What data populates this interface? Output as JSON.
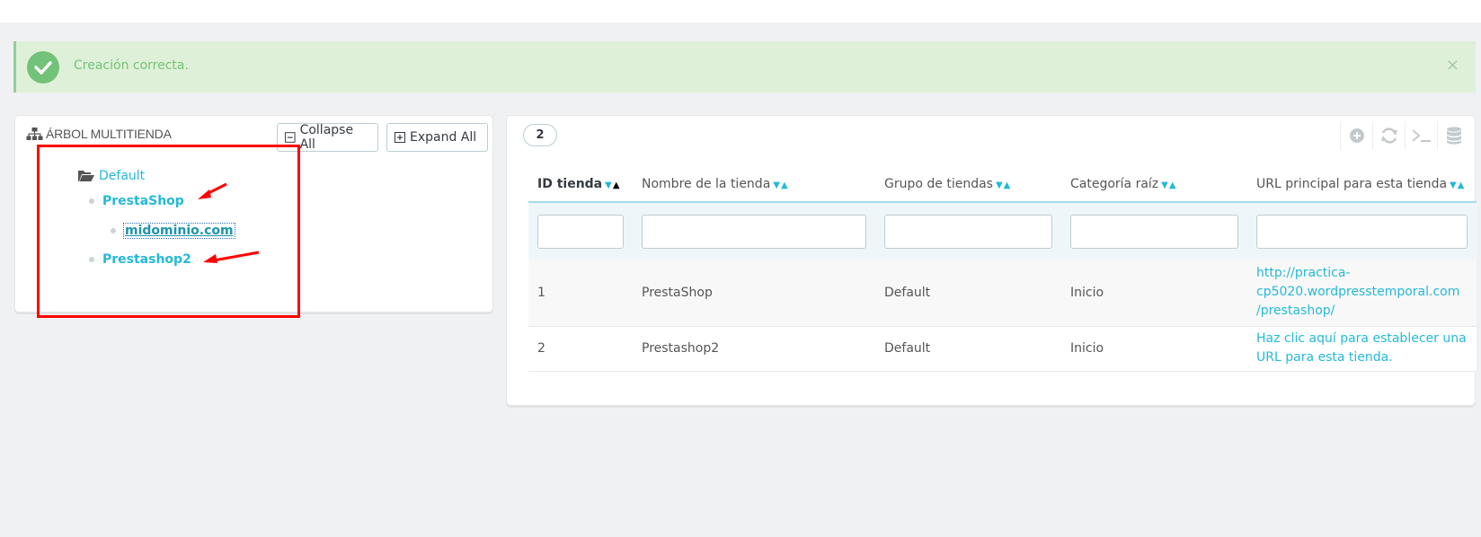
{
  "alert": {
    "message": "Creación correcta.",
    "close": "×",
    "icon": "check-circle-icon",
    "color": "#72c279"
  },
  "tree": {
    "title": "ÁRBOL MULTITIENDA",
    "collapse_label": "Collapse All",
    "expand_label": "Expand All",
    "root_label": "Default",
    "shop1_label": "PrestaShop",
    "shop1_url": "midominio.com",
    "shop2_label": "Prestashop2"
  },
  "list": {
    "count": "2",
    "columns": {
      "id": "ID tienda",
      "name": "Nombre de la tienda",
      "group": "Grupo de tiendas",
      "category": "Categoría raíz",
      "url": "URL principal para esta tienda"
    },
    "rows": [
      {
        "id": "1",
        "name": "PrestaShop",
        "group": "Default",
        "category": "Inicio",
        "url_line1": "http://practica-",
        "url_line2": "cp5020.wordpresstemporal.com",
        "url_line3": "/prestashop/"
      },
      {
        "id": "2",
        "name": "Prestashop2",
        "group": "Default",
        "category": "Inicio",
        "url_line1": "Haz clic aquí para establecer una",
        "url_line2": "URL para esta tienda."
      }
    ]
  },
  "colors": {
    "accent": "#25b9d7",
    "annotation": "#ff0000"
  }
}
